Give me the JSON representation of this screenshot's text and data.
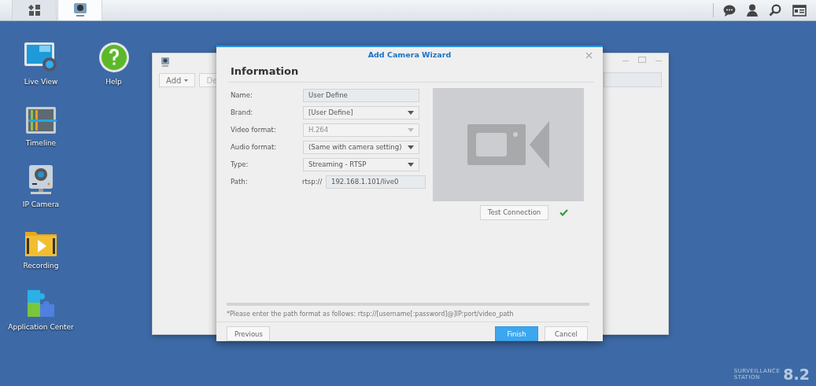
{
  "taskbar": {
    "items": [
      {
        "kind": "main-menu",
        "selected": false
      },
      {
        "kind": "camera-app",
        "selected": true
      }
    ]
  },
  "desktop_icons": [
    {
      "kind": "live-view",
      "label": "Live View"
    },
    {
      "kind": "help",
      "label": "Help"
    },
    {
      "kind": "timeline",
      "label": "Timeline"
    },
    {
      "kind": "ip-camera",
      "label": "IP Camera"
    },
    {
      "kind": "recording",
      "label": "Recording"
    },
    {
      "kind": "app-center",
      "label": "Application Center"
    }
  ],
  "background_window": {
    "toolbar": [
      "Add",
      "De"
    ]
  },
  "dialog": {
    "title": "Add Camera Wizard",
    "heading": "Information",
    "fields": [
      {
        "kind": "text",
        "label": "Name:",
        "value": "User Define",
        "disabled": false
      },
      {
        "kind": "select",
        "label": "Brand:",
        "value": "[User Define]",
        "disabled": false
      },
      {
        "kind": "select",
        "label": "Video format:",
        "value": "H.264",
        "disabled": true
      },
      {
        "kind": "select",
        "label": "Audio format:",
        "value": "(Same with camera setting)",
        "disabled": false
      },
      {
        "kind": "select",
        "label": "Type:",
        "value": "Streaming - RTSP",
        "disabled": false
      },
      {
        "kind": "path",
        "label": "Path:",
        "prefix": "rtsp://",
        "value": "192.168.1.101/live0",
        "disabled": false
      }
    ],
    "test_button": "Test Connection",
    "connection_ok": true,
    "progress": {
      "level": 0
    },
    "note": "*Please enter the path format as follows: rtsp://[username[:password]@]IP:port/video_path",
    "buttons": [
      {
        "label": "Previous",
        "kind": "secondary"
      },
      {
        "label": "Finish",
        "kind": "primary"
      },
      {
        "label": "Cancel",
        "kind": "secondary"
      }
    ]
  },
  "logo": {
    "line_1": "SURVEILLANCE",
    "line_2": "STATION",
    "version": "8.2"
  }
}
